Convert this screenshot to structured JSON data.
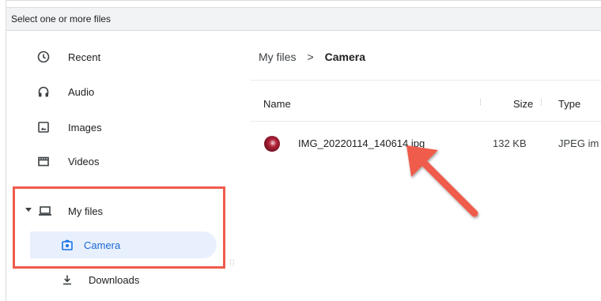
{
  "dialog": {
    "title": "Select one or more files"
  },
  "sidebar": {
    "items": [
      {
        "label": "Recent",
        "icon": "clock-icon"
      },
      {
        "label": "Audio",
        "icon": "headphones-icon"
      },
      {
        "label": "Images",
        "icon": "image-icon"
      },
      {
        "label": "Videos",
        "icon": "film-icon"
      },
      {
        "label": "My files",
        "icon": "laptop-icon"
      },
      {
        "label": "Camera",
        "icon": "camera-icon"
      },
      {
        "label": "Downloads",
        "icon": "download-icon"
      }
    ]
  },
  "breadcrumb": {
    "root": "My files",
    "separator": ">",
    "current": "Camera"
  },
  "columns": {
    "name": "Name",
    "size": "Size",
    "type": "Type"
  },
  "files": [
    {
      "name": "IMG_20220114_140614.jpg",
      "size": "132 KB",
      "type": "JPEG im"
    }
  ],
  "colors": {
    "selected_bg": "#e8f0fe",
    "selected_text": "#1967d2",
    "annotation": "#ef5b4c"
  }
}
